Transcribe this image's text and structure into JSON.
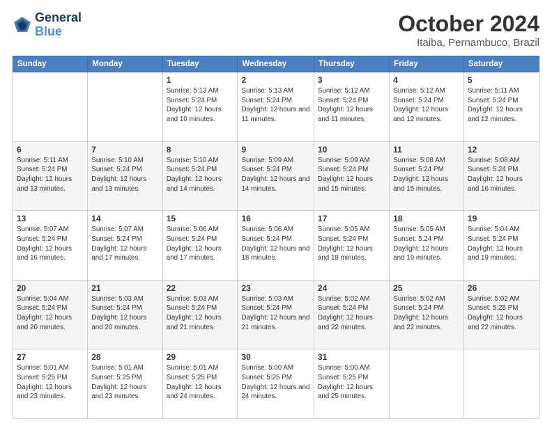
{
  "header": {
    "logo_line1": "General",
    "logo_line2": "Blue",
    "month": "October 2024",
    "location": "Itaiba, Pernambuco, Brazil"
  },
  "days_of_week": [
    "Sunday",
    "Monday",
    "Tuesday",
    "Wednesday",
    "Thursday",
    "Friday",
    "Saturday"
  ],
  "weeks": [
    [
      {
        "day": "",
        "info": ""
      },
      {
        "day": "",
        "info": ""
      },
      {
        "day": "1",
        "info": "Sunrise: 5:13 AM\nSunset: 5:24 PM\nDaylight: 12 hours\nand 10 minutes."
      },
      {
        "day": "2",
        "info": "Sunrise: 5:13 AM\nSunset: 5:24 PM\nDaylight: 12 hours\nand 11 minutes."
      },
      {
        "day": "3",
        "info": "Sunrise: 5:12 AM\nSunset: 5:24 PM\nDaylight: 12 hours\nand 11 minutes."
      },
      {
        "day": "4",
        "info": "Sunrise: 5:12 AM\nSunset: 5:24 PM\nDaylight: 12 hours\nand 12 minutes."
      },
      {
        "day": "5",
        "info": "Sunrise: 5:11 AM\nSunset: 5:24 PM\nDaylight: 12 hours\nand 12 minutes."
      }
    ],
    [
      {
        "day": "6",
        "info": "Sunrise: 5:11 AM\nSunset: 5:24 PM\nDaylight: 12 hours\nand 13 minutes."
      },
      {
        "day": "7",
        "info": "Sunrise: 5:10 AM\nSunset: 5:24 PM\nDaylight: 12 hours\nand 13 minutes."
      },
      {
        "day": "8",
        "info": "Sunrise: 5:10 AM\nSunset: 5:24 PM\nDaylight: 12 hours\nand 14 minutes."
      },
      {
        "day": "9",
        "info": "Sunrise: 5:09 AM\nSunset: 5:24 PM\nDaylight: 12 hours\nand 14 minutes."
      },
      {
        "day": "10",
        "info": "Sunrise: 5:09 AM\nSunset: 5:24 PM\nDaylight: 12 hours\nand 15 minutes."
      },
      {
        "day": "11",
        "info": "Sunrise: 5:08 AM\nSunset: 5:24 PM\nDaylight: 12 hours\nand 15 minutes."
      },
      {
        "day": "12",
        "info": "Sunrise: 5:08 AM\nSunset: 5:24 PM\nDaylight: 12 hours\nand 16 minutes."
      }
    ],
    [
      {
        "day": "13",
        "info": "Sunrise: 5:07 AM\nSunset: 5:24 PM\nDaylight: 12 hours\nand 16 minutes."
      },
      {
        "day": "14",
        "info": "Sunrise: 5:07 AM\nSunset: 5:24 PM\nDaylight: 12 hours\nand 17 minutes."
      },
      {
        "day": "15",
        "info": "Sunrise: 5:06 AM\nSunset: 5:24 PM\nDaylight: 12 hours\nand 17 minutes."
      },
      {
        "day": "16",
        "info": "Sunrise: 5:06 AM\nSunset: 5:24 PM\nDaylight: 12 hours\nand 18 minutes."
      },
      {
        "day": "17",
        "info": "Sunrise: 5:05 AM\nSunset: 5:24 PM\nDaylight: 12 hours\nand 18 minutes."
      },
      {
        "day": "18",
        "info": "Sunrise: 5:05 AM\nSunset: 5:24 PM\nDaylight: 12 hours\nand 19 minutes."
      },
      {
        "day": "19",
        "info": "Sunrise: 5:04 AM\nSunset: 5:24 PM\nDaylight: 12 hours\nand 19 minutes."
      }
    ],
    [
      {
        "day": "20",
        "info": "Sunrise: 5:04 AM\nSunset: 5:24 PM\nDaylight: 12 hours\nand 20 minutes."
      },
      {
        "day": "21",
        "info": "Sunrise: 5:03 AM\nSunset: 5:24 PM\nDaylight: 12 hours\nand 20 minutes."
      },
      {
        "day": "22",
        "info": "Sunrise: 5:03 AM\nSunset: 5:24 PM\nDaylight: 12 hours\nand 21 minutes."
      },
      {
        "day": "23",
        "info": "Sunrise: 5:03 AM\nSunset: 5:24 PM\nDaylight: 12 hours\nand 21 minutes."
      },
      {
        "day": "24",
        "info": "Sunrise: 5:02 AM\nSunset: 5:24 PM\nDaylight: 12 hours\nand 22 minutes."
      },
      {
        "day": "25",
        "info": "Sunrise: 5:02 AM\nSunset: 5:24 PM\nDaylight: 12 hours\nand 22 minutes."
      },
      {
        "day": "26",
        "info": "Sunrise: 5:02 AM\nSunset: 5:25 PM\nDaylight: 12 hours\nand 22 minutes."
      }
    ],
    [
      {
        "day": "27",
        "info": "Sunrise: 5:01 AM\nSunset: 5:25 PM\nDaylight: 12 hours\nand 23 minutes."
      },
      {
        "day": "28",
        "info": "Sunrise: 5:01 AM\nSunset: 5:25 PM\nDaylight: 12 hours\nand 23 minutes."
      },
      {
        "day": "29",
        "info": "Sunrise: 5:01 AM\nSunset: 5:25 PM\nDaylight: 12 hours\nand 24 minutes."
      },
      {
        "day": "30",
        "info": "Sunrise: 5:00 AM\nSunset: 5:25 PM\nDaylight: 12 hours\nand 24 minutes."
      },
      {
        "day": "31",
        "info": "Sunrise: 5:00 AM\nSunset: 5:25 PM\nDaylight: 12 hours\nand 25 minutes."
      },
      {
        "day": "",
        "info": ""
      },
      {
        "day": "",
        "info": ""
      }
    ]
  ]
}
